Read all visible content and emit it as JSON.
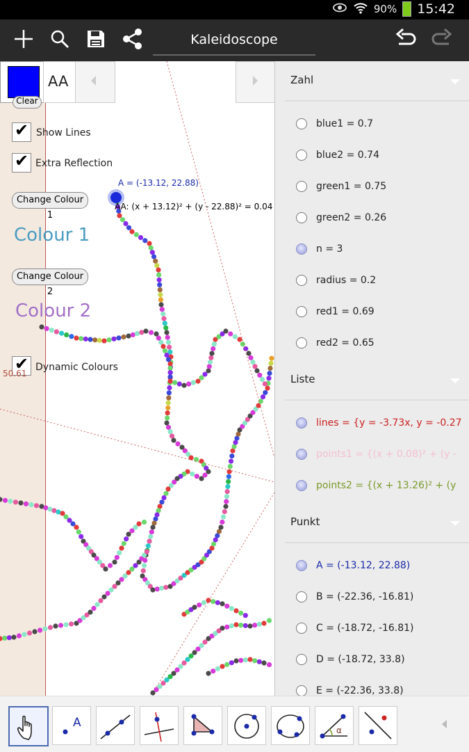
{
  "status_bar": {
    "battery": "90%",
    "time": "15:42"
  },
  "app": {
    "title": "Kaleidoscope"
  },
  "style_bar": {
    "text_style": "AA",
    "color": "#0000ff"
  },
  "graphics": {
    "clear_label": "Clear",
    "show_lines": {
      "label": "Show Lines",
      "checked": true
    },
    "extra_reflection": {
      "label": "Extra Reflection",
      "checked": true
    },
    "change_colour_1": "Change Colour 1",
    "colour_1_text": "Colour 1",
    "change_colour_2": "Change Colour 2",
    "colour_2_text": "Colour 2",
    "dynamic_colours": {
      "label": "Dynamic Colours",
      "checked": true
    },
    "point_label": "A = (-13.12, 22.88)",
    "circle_label": "AA: (x + 13.12)² + (y - 22.88)² = 0.04",
    "axis_tick": "50.61",
    "colour_1_color": "#4a9cc2",
    "colour_2_color": "#a270c8"
  },
  "algebra": {
    "sections": [
      {
        "title": "Zahl",
        "items": [
          {
            "text": "blue1 = 0.7",
            "on": false,
            "color": "#222222"
          },
          {
            "text": "blue2 = 0.74",
            "on": false,
            "color": "#222222"
          },
          {
            "text": "green1 = 0.75",
            "on": false,
            "color": "#222222"
          },
          {
            "text": "green2 = 0.26",
            "on": false,
            "color": "#222222"
          },
          {
            "text": "n = 3",
            "on": true,
            "color": "#222222"
          },
          {
            "text": "radius = 0.2",
            "on": false,
            "color": "#222222"
          },
          {
            "text": "red1 = 0.69",
            "on": false,
            "color": "#222222"
          },
          {
            "text": "red2 = 0.65",
            "on": false,
            "color": "#222222"
          }
        ]
      },
      {
        "title": "Liste",
        "items": [
          {
            "text": "lines = {y = -3.73x, y = -0.27",
            "on": true,
            "color": "#cc2222"
          },
          {
            "text": "points1 = {(x + 0.08)² + (y -",
            "on": true,
            "color": "#f4c0d0"
          },
          {
            "text": "points2 = {(x + 13.26)² + (y",
            "on": true,
            "color": "#7a9a2a"
          }
        ]
      },
      {
        "title": "Punkt",
        "items": [
          {
            "text": "A = (-13.12, 22.88)",
            "on": true,
            "color": "#1a2aa8"
          },
          {
            "text": "B = (-22.36, -16.81)",
            "on": false,
            "color": "#222222"
          },
          {
            "text": "C = (-18.72, -16.81)",
            "on": false,
            "color": "#222222"
          },
          {
            "text": "D = (-18.72, 33.8)",
            "on": false,
            "color": "#222222"
          },
          {
            "text": "E = (-22.36, 33.8)",
            "on": false,
            "color": "#222222"
          }
        ]
      }
    ]
  },
  "toolbar": {
    "tools": [
      "move-tool",
      "point-tool",
      "line-tool",
      "perpendicular-line-tool",
      "polygon-tool",
      "circle-center-point-tool",
      "circle-three-points-tool",
      "angle-tool",
      "reflect-about-line-tool"
    ],
    "point_tool_letter": "A",
    "angle_letter": "α"
  }
}
